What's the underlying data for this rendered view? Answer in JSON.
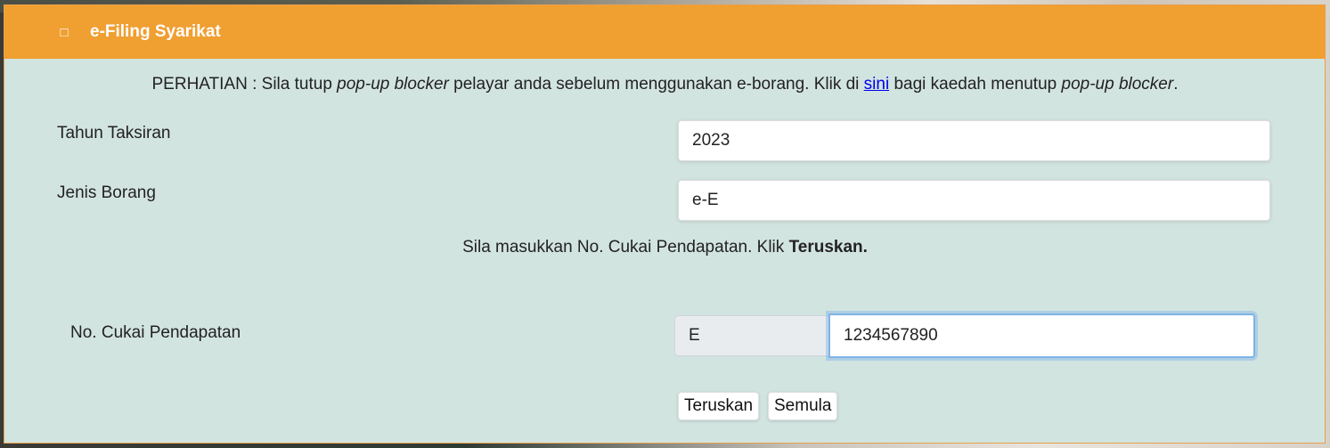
{
  "header": {
    "icon": "file-icon",
    "icon_glyph": "□",
    "title": "e-Filing Syarikat",
    "color": "#f09f31"
  },
  "notice": {
    "prefix": "PERHATIAN : Sila tutup ",
    "italic1": "pop-up blocker",
    "middle": " pelayar anda sebelum menggunakan e-borang. Klik di ",
    "link_text": "sini",
    "after_link": " bagi kaedah menutup ",
    "italic2": "pop-up blocker",
    "end": "."
  },
  "form": {
    "tahun_label": "Tahun Taksiran",
    "tahun_value": "2023",
    "jenis_label": "Jenis Borang",
    "jenis_value": "e-E",
    "instruction_text": "Sila masukkan No. Cukai Pendapatan. Klik ",
    "instruction_bold": "Teruskan.",
    "tax_label": "No. Cukai Pendapatan",
    "tax_prefix": "E",
    "tax_value": "1234567890"
  },
  "buttons": {
    "continue": "Teruskan",
    "reset": "Semula"
  },
  "colors": {
    "panel_bg": "#d2e4e0",
    "link": "#0000ee",
    "focus_border": "#80b3e6"
  }
}
